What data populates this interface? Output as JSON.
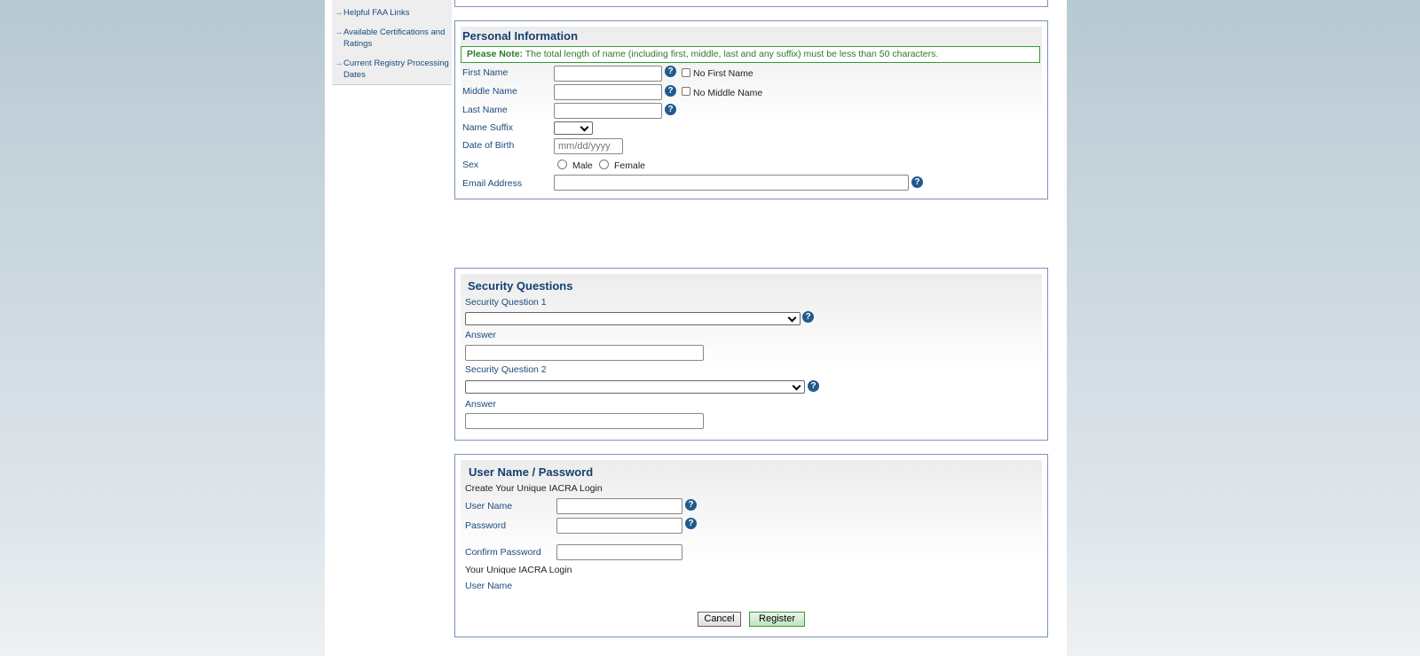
{
  "sidebar": {
    "links": [
      "Helpful FAA Links",
      "Available Certifications and Ratings",
      "Current Registry Processing Dates"
    ]
  },
  "personal": {
    "title": "Personal Information",
    "note_bold": "Please Note:",
    "note": " The total length of name (including first, middle, last and any suffix) must be less than 50 characters.",
    "first_name": "First Name",
    "no_first": "No First Name",
    "middle_name": "Middle Name",
    "no_middle": "No Middle Name",
    "last_name": "Last Name",
    "suffix": "Name Suffix",
    "dob": "Date of Birth",
    "dob_placeholder": "mm/dd/yyyy",
    "sex": "Sex",
    "male": "Male",
    "female": "Female",
    "email": "Email Address"
  },
  "security": {
    "title": "Security Questions",
    "q1": "Security Question 1",
    "a1": "Answer",
    "q2": "Security Question 2",
    "a2": "Answer"
  },
  "login": {
    "title": "User Name / Password",
    "subtitle": "Create Your Unique IACRA Login",
    "username": "User Name",
    "password": "Password",
    "confirm": "Confirm Password",
    "your_login": "Your Unique IACRA Login",
    "username2": "User Name",
    "cancel": "Cancel",
    "register": "Register"
  },
  "help_glyph": "?"
}
